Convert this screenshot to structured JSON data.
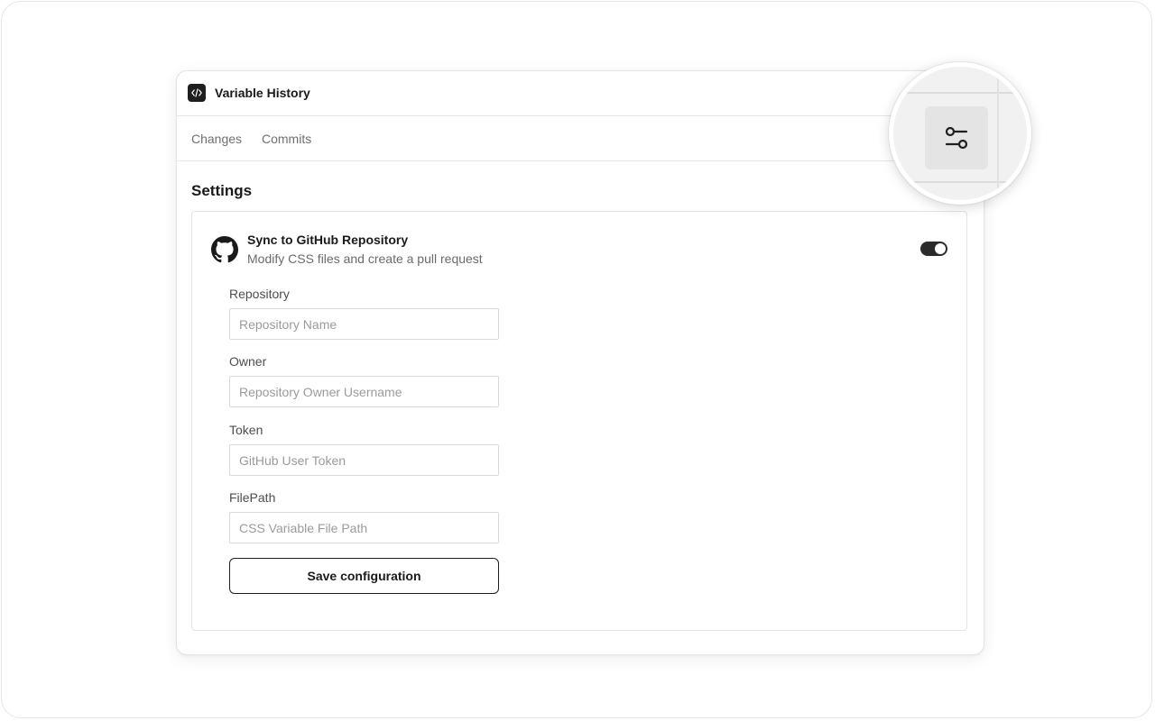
{
  "window": {
    "title": "Variable History"
  },
  "tabs": [
    {
      "label": "Changes"
    },
    {
      "label": "Commits"
    }
  ],
  "settings": {
    "heading": "Settings",
    "sync": {
      "title": "Sync to GitHub Repository",
      "subtitle": "Modify CSS files and create a pull request",
      "enabled": true
    },
    "fields": [
      {
        "label": "Repository",
        "placeholder": "Repository Name",
        "value": ""
      },
      {
        "label": "Owner",
        "placeholder": "Repository Owner Username",
        "value": ""
      },
      {
        "label": "Token",
        "placeholder": "GitHub User Token",
        "value": ""
      },
      {
        "label": "FilePath",
        "placeholder": "CSS Variable File Path",
        "value": ""
      }
    ],
    "save_label": "Save configuration"
  },
  "icons": {
    "app": "code-icon",
    "repo_provider": "github-icon",
    "settings_button": "sliders-icon"
  },
  "colors": {
    "accent": "#1e1e1e",
    "toggle_on": "#2b2b2b"
  }
}
